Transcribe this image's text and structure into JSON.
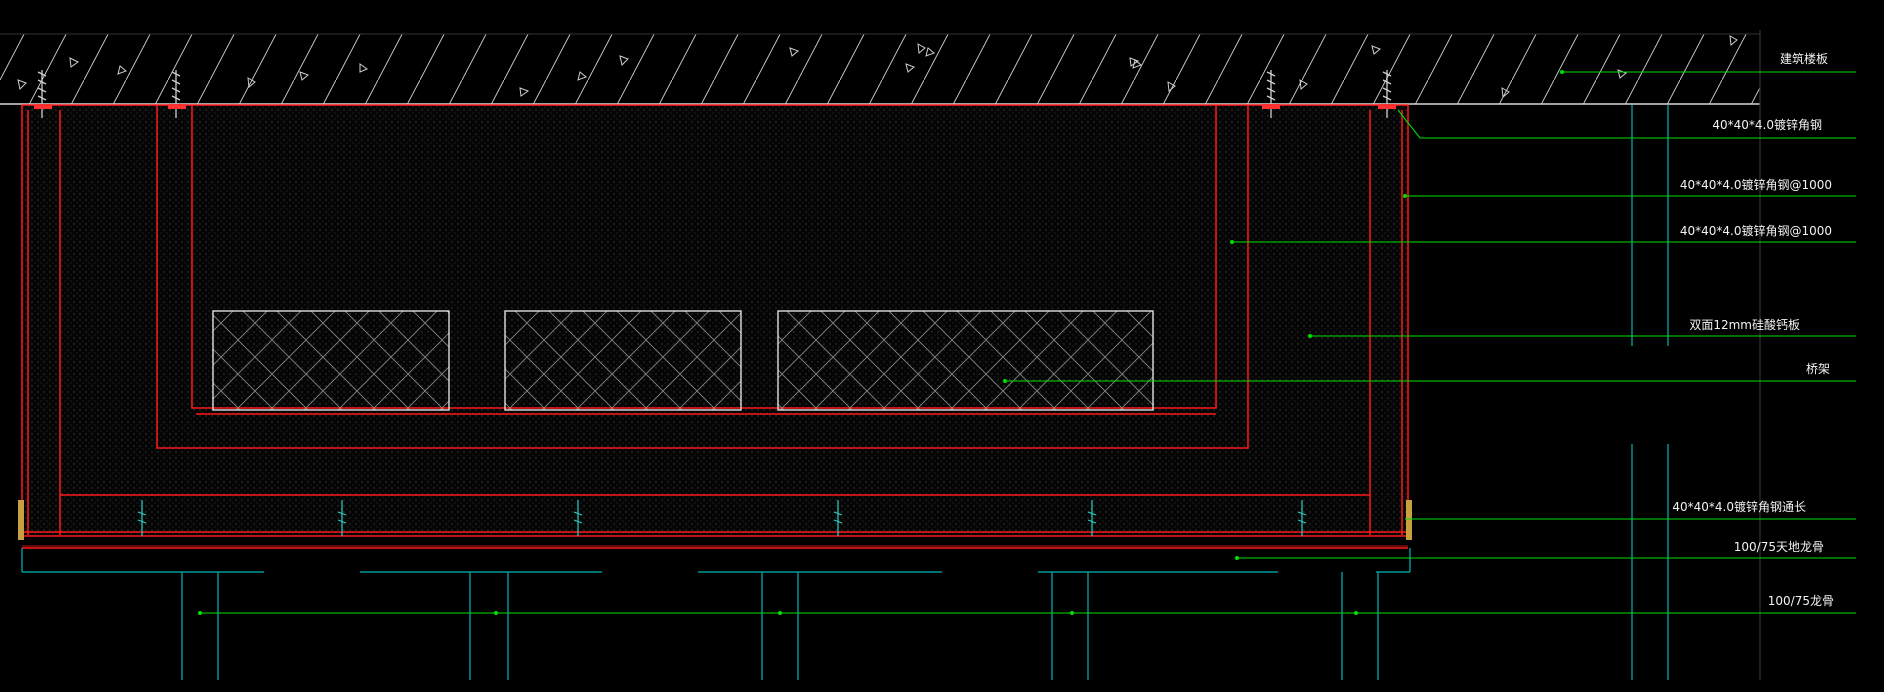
{
  "labels": {
    "slab": "建筑楼板",
    "angle_top": "40*40*4.0镀锌角钢",
    "angle_1000_a": "40*40*4.0镀锌角钢@1000",
    "angle_1000_b": "40*40*4.0镀锌角钢@1000",
    "board": "双面12mm硅酸钙板",
    "tray": "桥架",
    "angle_long": "40*40*4.0镀锌角钢通长",
    "track": "100/75天地龙骨",
    "stud": "100/75龙骨"
  },
  "colors": {
    "background": "#000000",
    "outline": "#ff1a1a",
    "leader": "#00e000",
    "stud": "#00b7b7",
    "slab_hatch": "#d8d8d8",
    "text": "#f2f2f2"
  }
}
